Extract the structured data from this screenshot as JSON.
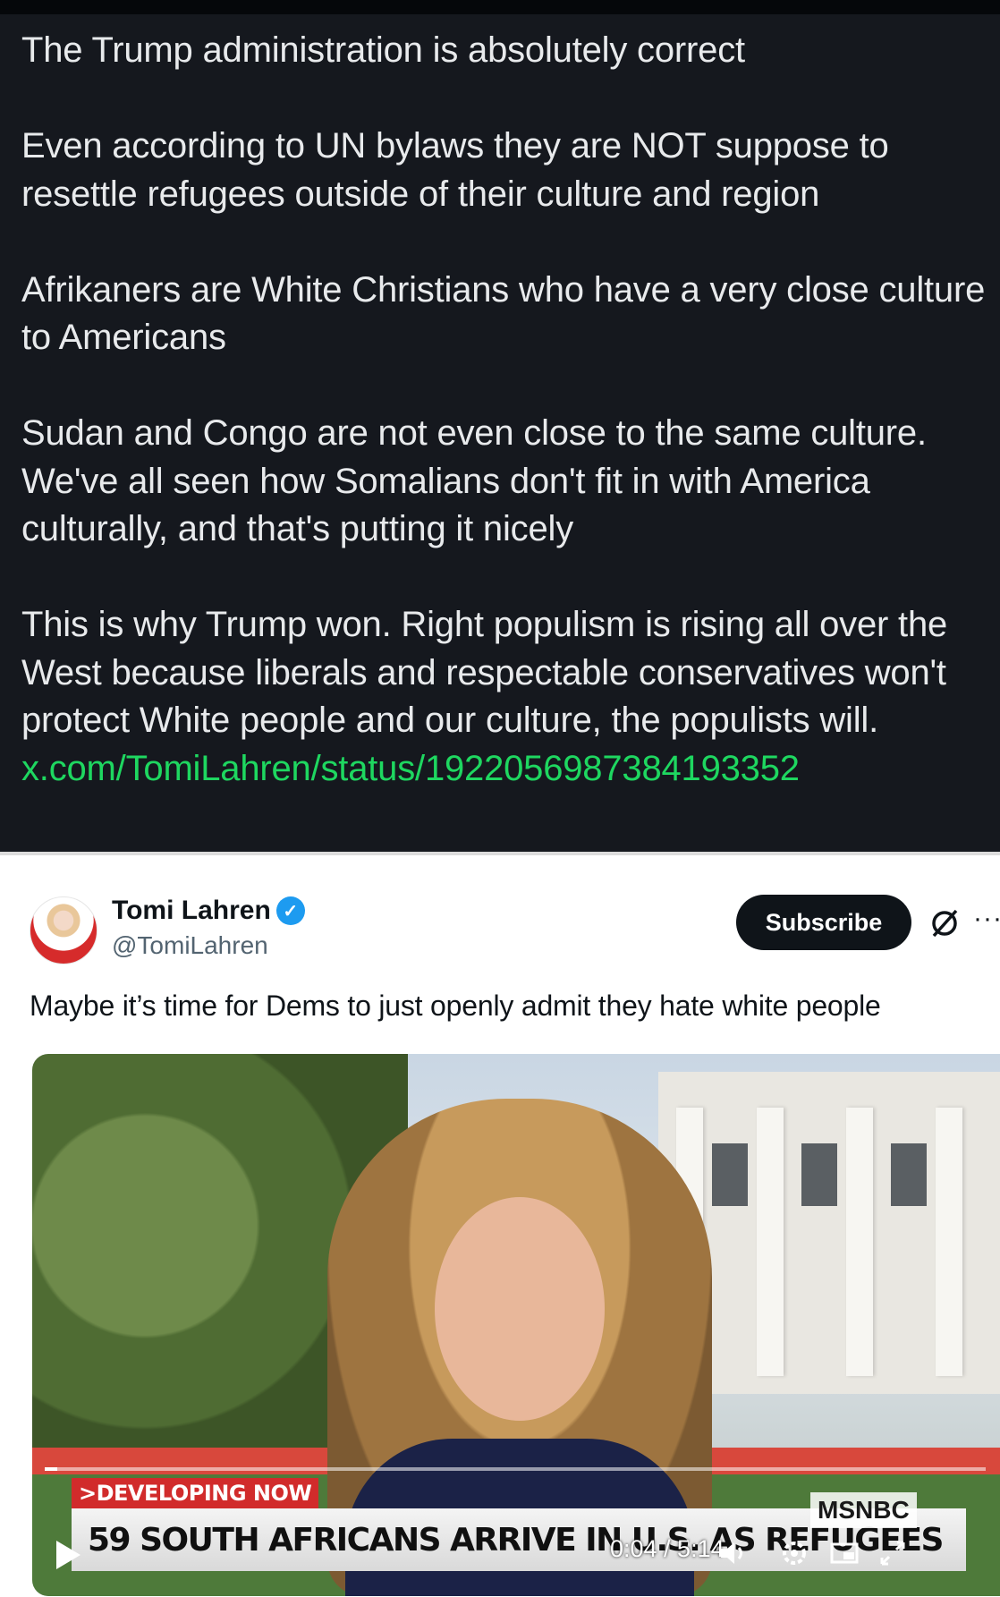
{
  "post": {
    "paragraphs": [
      "The Trump administration is absolutely correct",
      "Even according to UN bylaws they are NOT suppose to resettle refugees outside of their culture and region",
      "Afrikaners are White Christians who have a very close culture to Americans",
      "Sudan and Congo are not even close to the same culture. We've all seen how Somalians don't fit in with America culturally, and that's putting it nicely",
      "This is why Trump won. Right populism is rising all over the West because liberals and respectable conservatives won't protect White people and our culture, the populists will."
    ],
    "link": "x.com/TomiLahren/status/1922056987384193352"
  },
  "quoted": {
    "name": "Tomi Lahren",
    "handle": "@TomiLahren",
    "subscribe_label": "Subscribe",
    "more_label": "···",
    "verified_mark": "✓",
    "text": "Maybe it’s time for Dems to just openly admit they hate white people",
    "video": {
      "developing": ">DEVELOPING NOW",
      "headline": "59 SOUTH AFRICANS ARRIVE IN U.S. AS REFUGEES",
      "network": "MSNBC",
      "time": "0:04 / 5:14",
      "progress": 0.013
    }
  },
  "colors": {
    "dark_bg": "#15181e",
    "link": "#1ed760",
    "verified": "#1d9bf0"
  },
  "icons": [
    "verified-badge-icon",
    "grok-icon",
    "more-icon",
    "play-icon",
    "volume-icon",
    "settings-icon",
    "pip-icon",
    "fullscreen-icon"
  ]
}
